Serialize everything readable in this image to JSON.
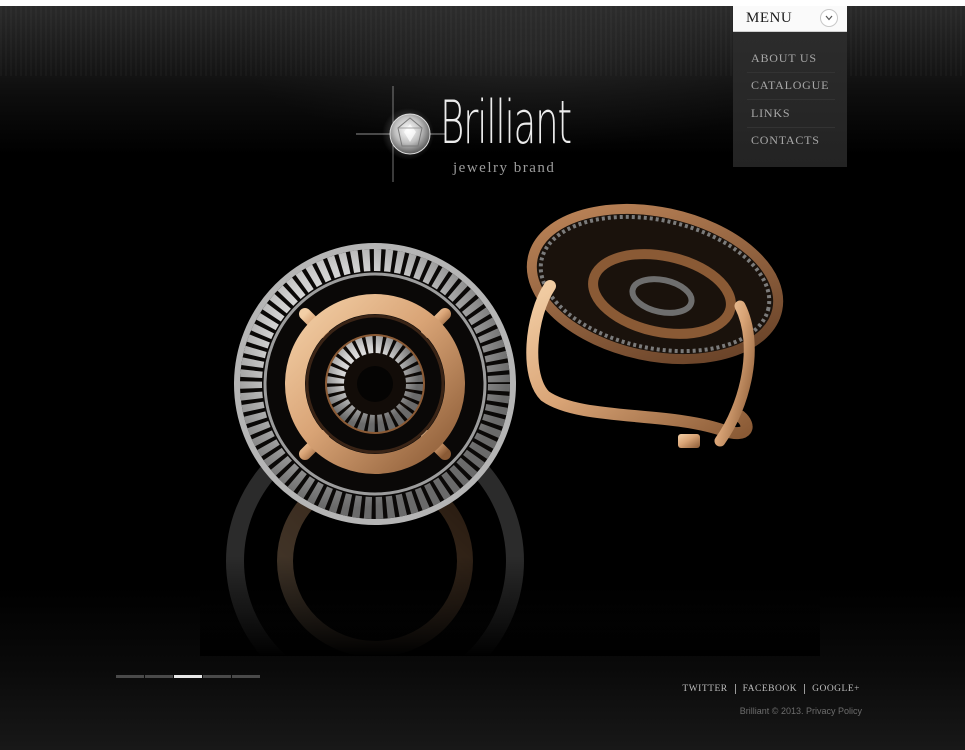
{
  "brand": {
    "title": "Brilliant",
    "tagline": "jewelry brand",
    "logo_icon": "diamond-sparkle-icon"
  },
  "menu": {
    "label": "MENU",
    "toggle_icon": "chevron-down-icon",
    "items": [
      {
        "label": "ABOUT US"
      },
      {
        "label": "CATALOGUE"
      },
      {
        "label": "LINKS"
      },
      {
        "label": "CONTACTS"
      }
    ]
  },
  "slider": {
    "slide_count": 5,
    "active_index": 2
  },
  "footer": {
    "social": [
      {
        "label": "TWITTER"
      },
      {
        "label": "FACEBOOK"
      },
      {
        "label": "GOOGLE+"
      }
    ],
    "copyright_text": "Brilliant © 2013.",
    "privacy_label": "Privacy Policy"
  },
  "colors": {
    "background": "#000000",
    "menu_header_bg": "#fafafa",
    "menu_panel_bg": "#262626",
    "gold": "#d9a476",
    "menu_text": "#a8a8a8"
  }
}
